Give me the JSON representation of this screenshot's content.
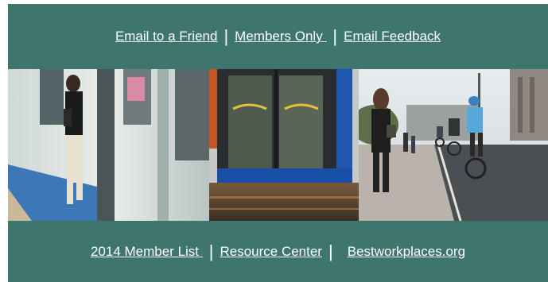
{
  "colors": {
    "band": "#3e756d",
    "link": "#ffffff"
  },
  "top_nav": {
    "links": [
      {
        "label": "Email to a Friend"
      },
      {
        "label": "Members Only "
      },
      {
        "label": "Email Feedback"
      }
    ],
    "separator": "|"
  },
  "bottom_nav": {
    "links": [
      {
        "label": "2014 Member List "
      },
      {
        "label": "Resource Center"
      },
      {
        "label": "Bestworkplaces.org"
      }
    ],
    "separator": "|"
  },
  "photos": [
    {
      "icon": "train-boarding-photo"
    },
    {
      "icon": "bus-doors-photo"
    },
    {
      "icon": "cyclists-street-photo"
    }
  ]
}
